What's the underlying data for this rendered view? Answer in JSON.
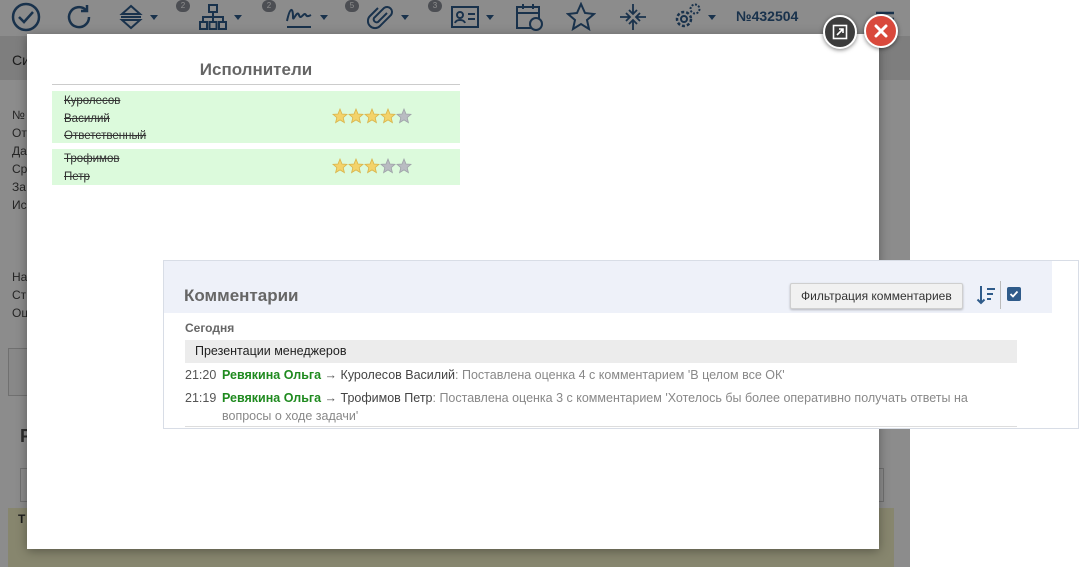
{
  "toolbar": {
    "badges": [
      "2",
      "2",
      "5",
      "3"
    ],
    "doc_number": "№432504"
  },
  "background": {
    "tab_label": "Си",
    "side_labels": [
      "№",
      "От",
      "Да",
      "",
      "Ср",
      "За",
      "Ис",
      "",
      "",
      "",
      "На",
      "Ст",
      "Оц"
    ],
    "section_letter": "Р",
    "strip_label": "Т"
  },
  "executors": {
    "title": "Исполнители",
    "rows": [
      {
        "name_lines": [
          "Куролесов",
          "Василий",
          "Ответственный"
        ],
        "rating": 4,
        "max": 5
      },
      {
        "name_lines": [
          "Трофимов",
          "Петр"
        ],
        "rating": 3,
        "max": 5
      }
    ]
  },
  "comments": {
    "title": "Комментарии",
    "filter_label": "Фильтрация комментариев",
    "day_label": "Сегодня",
    "task_name": "Презентации менеджеров",
    "items": [
      {
        "time": "21:20",
        "author": "Ревякина Ольга",
        "arrow": "→",
        "target": "Куролесов Василий",
        "text": ": Поставлена оценка 4 с комментарием 'В целом все ОК'"
      },
      {
        "time": "21:19",
        "author": "Ревякина Ольга",
        "arrow": "→",
        "target": "Трофимов Петр",
        "text": ": Поставлена оценка 3 с комментарием 'Хотелось бы более оперативно получать ответы на вопросы о ходе задачи'"
      }
    ]
  },
  "colors": {
    "executor_row_bg": "#dcfadc",
    "author": "#1f8a1f",
    "star_on": "#f3d36b",
    "star_off": "#b9bcc2",
    "close_button": "#d9493c"
  }
}
